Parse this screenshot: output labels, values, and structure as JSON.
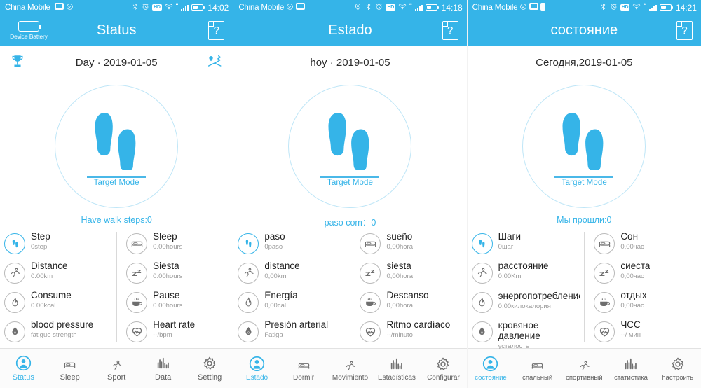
{
  "panels": [
    {
      "id": "panel-english",
      "statusbar": {
        "carrier": "China Mobile",
        "left_icons": [
          "sim-signal-icon",
          "data-transfer-icon",
          "check-circle-icon"
        ],
        "right_icons": [
          "bluetooth-icon",
          "alarm-icon",
          "hd-icon",
          "wifi-icon",
          "signal-bars-icon",
          "battery-icon"
        ],
        "hd_label": "HD",
        "time": "14:02"
      },
      "appbar": {
        "device_battery_label": "Device Battery",
        "title": "Status",
        "help_label": "?"
      },
      "date": {
        "text": "Day · 2019-01-05",
        "has_trophy": true,
        "has_route": true
      },
      "circle": {
        "target_label": "Target Mode"
      },
      "walk_line": "Have walk steps:0",
      "stats_left": [
        {
          "icon": "footsteps-icon",
          "name": "Step",
          "value": "0step",
          "active": true
        },
        {
          "icon": "running-icon",
          "name": "Distance",
          "value": "0.00km",
          "active": false
        },
        {
          "icon": "flame-icon",
          "name": "Consume",
          "value": "0.00kcal",
          "active": false
        },
        {
          "icon": "blood-drop-icon",
          "name": "blood pressure",
          "value": "fatigue strength",
          "active": false
        }
      ],
      "stats_right": [
        {
          "icon": "bed-icon",
          "name": "Sleep",
          "value": "0.00hours",
          "active": false
        },
        {
          "icon": "nap-zz-icon",
          "name": "Siesta",
          "value": "0.00hours",
          "active": false
        },
        {
          "icon": "coffee-cup-icon",
          "name": "Pause",
          "value": "0.00hours",
          "active": false
        },
        {
          "icon": "heart-pulse-icon",
          "name": "Heart rate",
          "value": "--/bpm",
          "active": false
        }
      ],
      "tabs": [
        {
          "icon": "person-status-icon",
          "label": "Status",
          "active": true
        },
        {
          "icon": "bed-icon",
          "label": "Sleep",
          "active": false
        },
        {
          "icon": "running-icon",
          "label": "Sport",
          "active": false
        },
        {
          "icon": "bar-chart-icon",
          "label": "Data",
          "active": false
        },
        {
          "icon": "gear-icon",
          "label": "Setting",
          "active": false
        }
      ],
      "tab_size": "normal"
    },
    {
      "id": "panel-spanish",
      "statusbar": {
        "carrier": "China Mobile",
        "left_icons": [
          "check-circle-icon",
          "data-transfer-icon"
        ],
        "right_icons": [
          "location-icon",
          "bluetooth-icon",
          "alarm-icon",
          "hd-icon",
          "wifi-icon",
          "signal-bars-icon",
          "battery-icon"
        ],
        "hd_label": "HD",
        "time": "14:18"
      },
      "appbar": {
        "device_battery_label": "",
        "title": "Estado",
        "help_label": "?"
      },
      "date": {
        "text": "hoy · 2019-01-05",
        "has_trophy": false,
        "has_route": false
      },
      "circle": {
        "target_label": "Target Mode"
      },
      "walk_line": "paso com：0",
      "stats_left": [
        {
          "icon": "footsteps-icon",
          "name": "paso",
          "value": "0paso",
          "active": true
        },
        {
          "icon": "running-icon",
          "name": "distance",
          "value": "0,00km",
          "active": false
        },
        {
          "icon": "flame-icon",
          "name": "Energía",
          "value": "0,00cal",
          "active": false
        },
        {
          "icon": "blood-drop-icon",
          "name": "Presión arterial",
          "value": "Fatiga",
          "active": false
        }
      ],
      "stats_right": [
        {
          "icon": "bed-icon",
          "name": "sueño",
          "value": "0,00hora",
          "active": false
        },
        {
          "icon": "nap-zz-icon",
          "name": "siesta",
          "value": "0,00hora",
          "active": false
        },
        {
          "icon": "coffee-cup-icon",
          "name": "Descanso",
          "value": "0,00hora",
          "active": false
        },
        {
          "icon": "heart-pulse-icon",
          "name": "Ritmo cardíaco",
          "value": "--/minuto",
          "active": false
        }
      ],
      "tabs": [
        {
          "icon": "person-status-icon",
          "label": "Estado",
          "active": true
        },
        {
          "icon": "bed-icon",
          "label": "Dormir",
          "active": false
        },
        {
          "icon": "running-icon",
          "label": "Movimiento",
          "active": false
        },
        {
          "icon": "bar-chart-icon",
          "label": "Estadísticas",
          "active": false
        },
        {
          "icon": "gear-icon",
          "label": "Configurar",
          "active": false
        }
      ],
      "tab_size": "compact"
    },
    {
      "id": "panel-russian",
      "statusbar": {
        "carrier": "China Mobile",
        "left_icons": [
          "check-circle-icon",
          "data-transfer-icon",
          "device-battery-icon"
        ],
        "right_icons": [
          "bluetooth-icon",
          "alarm-icon",
          "hd-icon",
          "wifi-icon",
          "signal-bars-icon",
          "battery-icon"
        ],
        "hd_label": "HD",
        "time": "14:21"
      },
      "appbar": {
        "device_battery_label": "",
        "title": "состояние",
        "help_label": "?"
      },
      "date": {
        "text": "Сегодня,2019-01-05",
        "has_trophy": false,
        "has_route": false
      },
      "circle": {
        "target_label": "Target Mode"
      },
      "walk_line": "Мы прошли:0",
      "stats_left": [
        {
          "icon": "footsteps-icon",
          "name": "Шаги",
          "value": "0шаг",
          "active": true
        },
        {
          "icon": "running-icon",
          "name": "расстояние",
          "value": "0,00Km",
          "active": false
        },
        {
          "icon": "flame-icon",
          "name": "энергопотребление",
          "value": "0,00килокалория",
          "active": false
        },
        {
          "icon": "blood-drop-icon",
          "name": "кровяное давление",
          "value": "усталость",
          "active": false
        }
      ],
      "stats_right": [
        {
          "icon": "bed-icon",
          "name": "Сон",
          "value": "0,00час",
          "active": false
        },
        {
          "icon": "nap-zz-icon",
          "name": "сиеста",
          "value": "0,00час",
          "active": false
        },
        {
          "icon": "coffee-cup-icon",
          "name": "отдых",
          "value": "0,00час",
          "active": false
        },
        {
          "icon": "heart-pulse-icon",
          "name": "ЧСС",
          "value": "--/ мин",
          "active": false
        }
      ],
      "tabs": [
        {
          "icon": "person-status-icon",
          "label": "состояние",
          "active": true
        },
        {
          "icon": "bed-icon",
          "label": "спальный",
          "active": false
        },
        {
          "icon": "running-icon",
          "label": "спортивный",
          "active": false
        },
        {
          "icon": "bar-chart-icon",
          "label": "статистика",
          "active": false
        },
        {
          "icon": "gear-icon",
          "label": "hастроить",
          "active": false
        }
      ],
      "tab_size": "tight"
    }
  ],
  "colors": {
    "accent": "#35b4e8",
    "header_bg": "#35b4e8",
    "tabbar_bg": "#fbfbfb",
    "circle_border": "#bfe6f7",
    "stat_icon_border": "#b9b9b9",
    "stat_value_text": "#9a9a9a",
    "stat_name_text": "#1f1f1f"
  }
}
